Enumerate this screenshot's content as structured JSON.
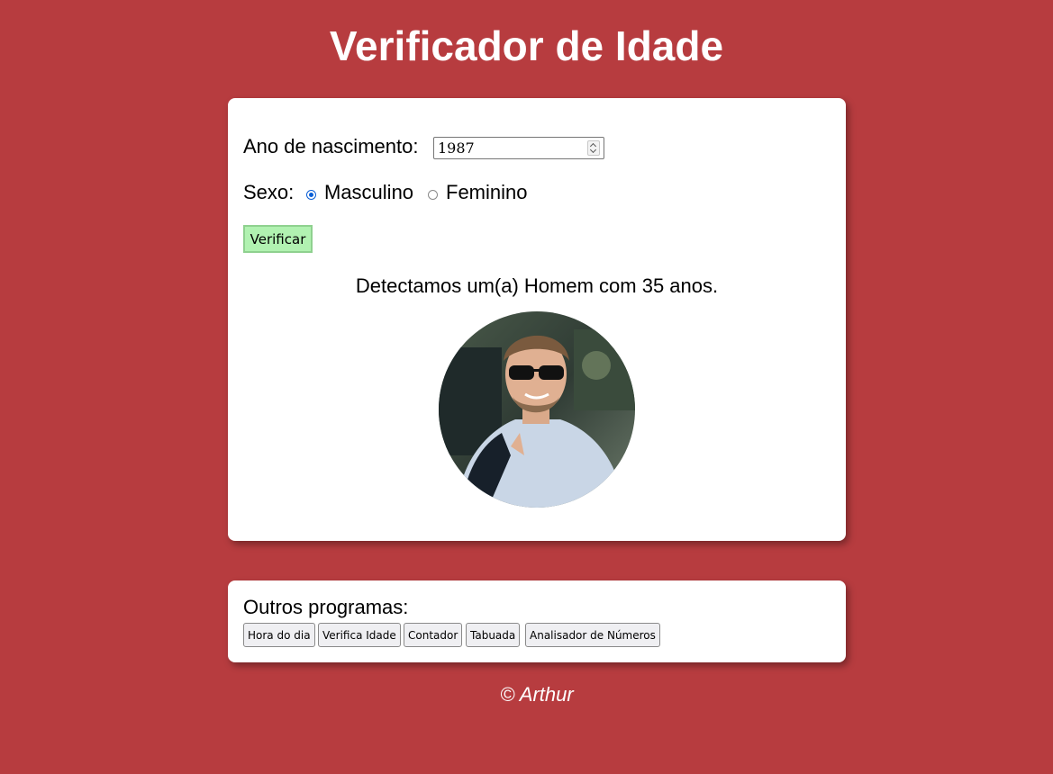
{
  "page": {
    "title": "Verificador de Idade"
  },
  "form": {
    "year_label": "Ano de nascimento:",
    "year_value": "1987",
    "sex_label": "Sexo:",
    "sex_options": [
      "Masculino",
      "Feminino"
    ],
    "sex_selected": "Masculino",
    "verify_label": "Verificar"
  },
  "result": {
    "text": "Detectamos um(a) Homem com 35 anos."
  },
  "other": {
    "title": "Outros programas:",
    "buttons": [
      "Hora do dia",
      "Verifica Idade",
      "Contador",
      "Tabuada",
      "Analisador de Números"
    ]
  },
  "footer": {
    "text": "© Arthur"
  },
  "colors": {
    "background": "#b73c3f",
    "verify_button": "#b1f2b1",
    "radio_checked": "#0b5fd6"
  },
  "icons": {
    "photo": "man-smiling-sunglasses-photo"
  }
}
